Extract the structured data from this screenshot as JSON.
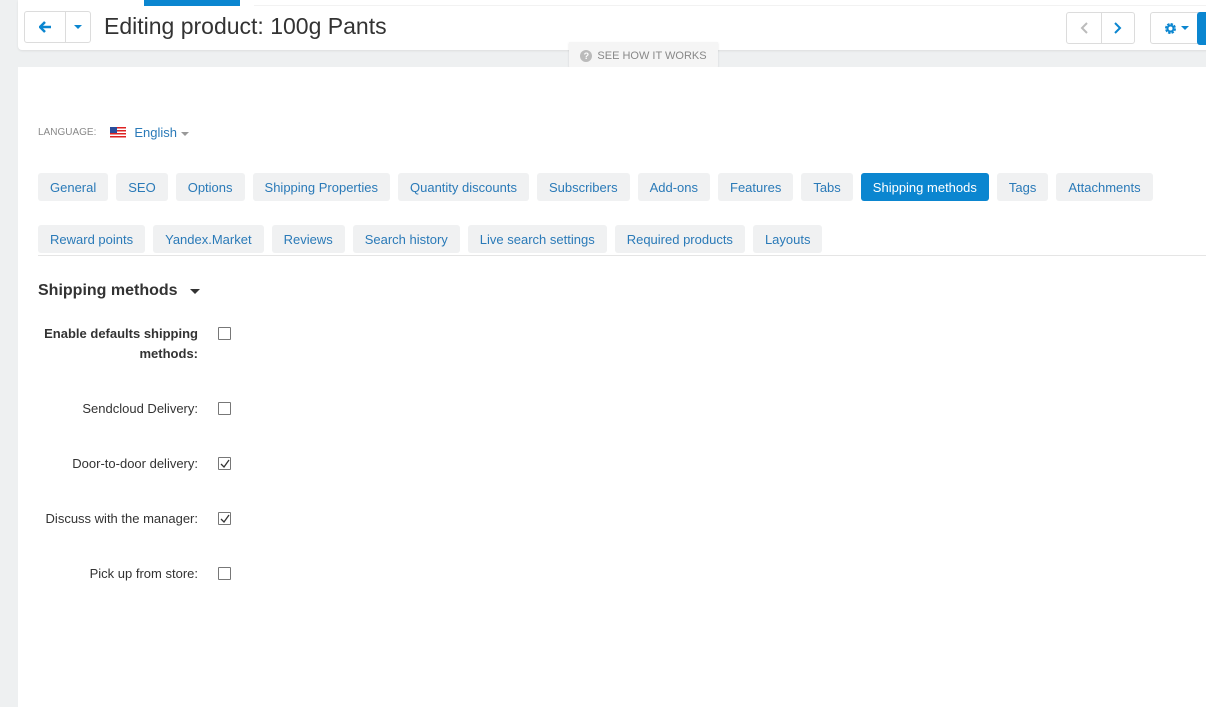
{
  "header": {
    "title": "Editing product: 100g Pants",
    "hint": "See how it works"
  },
  "language": {
    "label": "LANGUAGE:",
    "value": "English"
  },
  "tabs": [
    {
      "label": "General"
    },
    {
      "label": "SEO"
    },
    {
      "label": "Options"
    },
    {
      "label": "Shipping Properties"
    },
    {
      "label": "Quantity discounts"
    },
    {
      "label": "Subscribers"
    },
    {
      "label": "Add-ons"
    },
    {
      "label": "Features"
    },
    {
      "label": "Tabs"
    },
    {
      "label": "Shipping methods",
      "active": true
    },
    {
      "label": "Tags"
    },
    {
      "label": "Attachments"
    },
    {
      "label": "Reward points"
    },
    {
      "label": "Yandex.Market"
    },
    {
      "label": "Reviews"
    },
    {
      "label": "Search history"
    },
    {
      "label": "Live search settings"
    },
    {
      "label": "Required products"
    },
    {
      "label": "Layouts"
    }
  ],
  "section": {
    "title": "Shipping methods"
  },
  "fields": [
    {
      "label": "Enable defaults shipping methods:",
      "checked": false,
      "bold": true
    },
    {
      "label": "Sendcloud Delivery:",
      "checked": false
    },
    {
      "label": "Door-to-door delivery:",
      "checked": true
    },
    {
      "label": "Discuss with the manager:",
      "checked": true
    },
    {
      "label": "Pick up from store:",
      "checked": false
    }
  ],
  "colors": {
    "accent": "#0b86d0",
    "link": "#2a7ab8"
  }
}
